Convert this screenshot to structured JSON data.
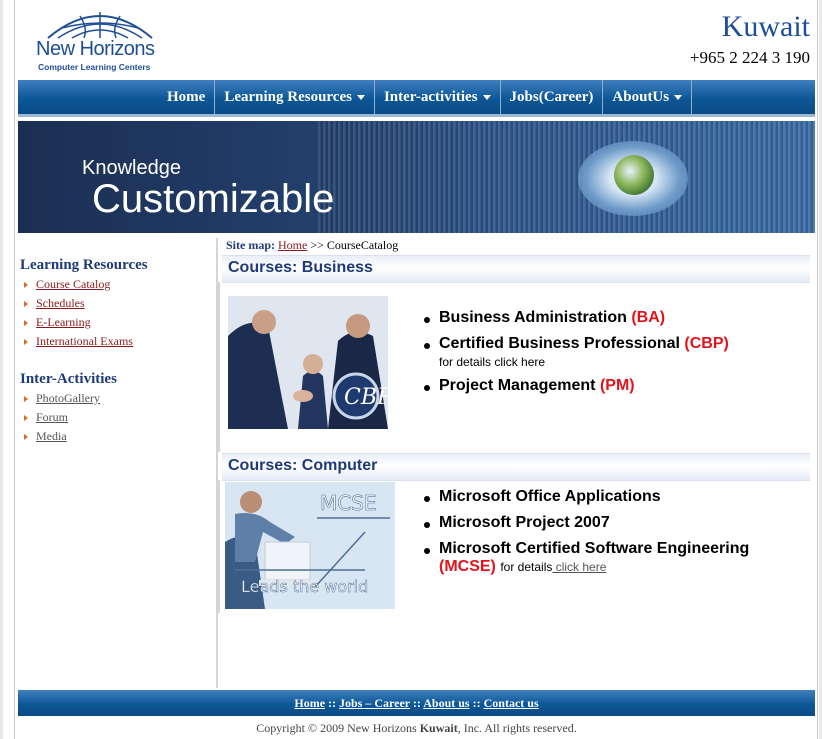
{
  "header": {
    "brand": "New Horizons",
    "brand_sub": "Computer Learning Centers",
    "country": "Kuwait",
    "phone": "+965 2 224 3 190"
  },
  "nav": {
    "items": [
      {
        "label": "Home",
        "dropdown": false
      },
      {
        "label": "Learning Resources",
        "dropdown": true
      },
      {
        "label": "Inter-activities",
        "dropdown": true
      },
      {
        "label": "Jobs(Career)",
        "dropdown": false
      },
      {
        "label": "AboutUs",
        "dropdown": true
      }
    ]
  },
  "banner": {
    "line1": "Knowledge",
    "line2": "Customizable"
  },
  "sitemap": {
    "label": "Site map:",
    "home": "Home",
    "sep": ">>",
    "current": "CourseCatalog"
  },
  "sidebar": {
    "learning_title": "Learning Resources",
    "learning_items": [
      "Course Catalog",
      "Schedules",
      "E-Learning",
      "International Exams"
    ],
    "inter_title": "Inter-Activities",
    "inter_items": [
      "PhotoGallery",
      "Forum",
      "Media"
    ]
  },
  "business": {
    "title": "Courses: Business",
    "items": [
      {
        "name": "Business Administration",
        "abbr": "(BA)"
      },
      {
        "name": "Certified Business Professional",
        "abbr": "(CBP)"
      },
      {
        "name": "Project Management",
        "abbr": "(PM)"
      }
    ],
    "details_text": "for details",
    "details_link": "click here",
    "photo_caption_letters": "CBP"
  },
  "computer": {
    "title": "Courses: Computer",
    "items": [
      {
        "name": "Microsoft Office Applications"
      },
      {
        "name": "Microsoft Project 2007"
      },
      {
        "name": "Microsoft Certified Software Engineering",
        "abbr": "(MCSE)"
      }
    ],
    "details_text": "for details",
    "details_link": " click here",
    "photo_mcse": "MCSE",
    "photo_tagline": "Leads the world"
  },
  "footer": {
    "links": [
      "Home",
      "Jobs – Career",
      "About us",
      "Contact us"
    ],
    "sep": "::",
    "copyright_pre": "Copyright © 2009 New Horizons",
    "copyright_bold": "Kuwait",
    "copyright_post": ", Inc. All rights reserved."
  },
  "colors": {
    "nav_blue": "#0d5796",
    "heading_blue": "#1f3a78",
    "abbr_red": "#e0141c",
    "link_maroon": "#8b1a1a"
  }
}
